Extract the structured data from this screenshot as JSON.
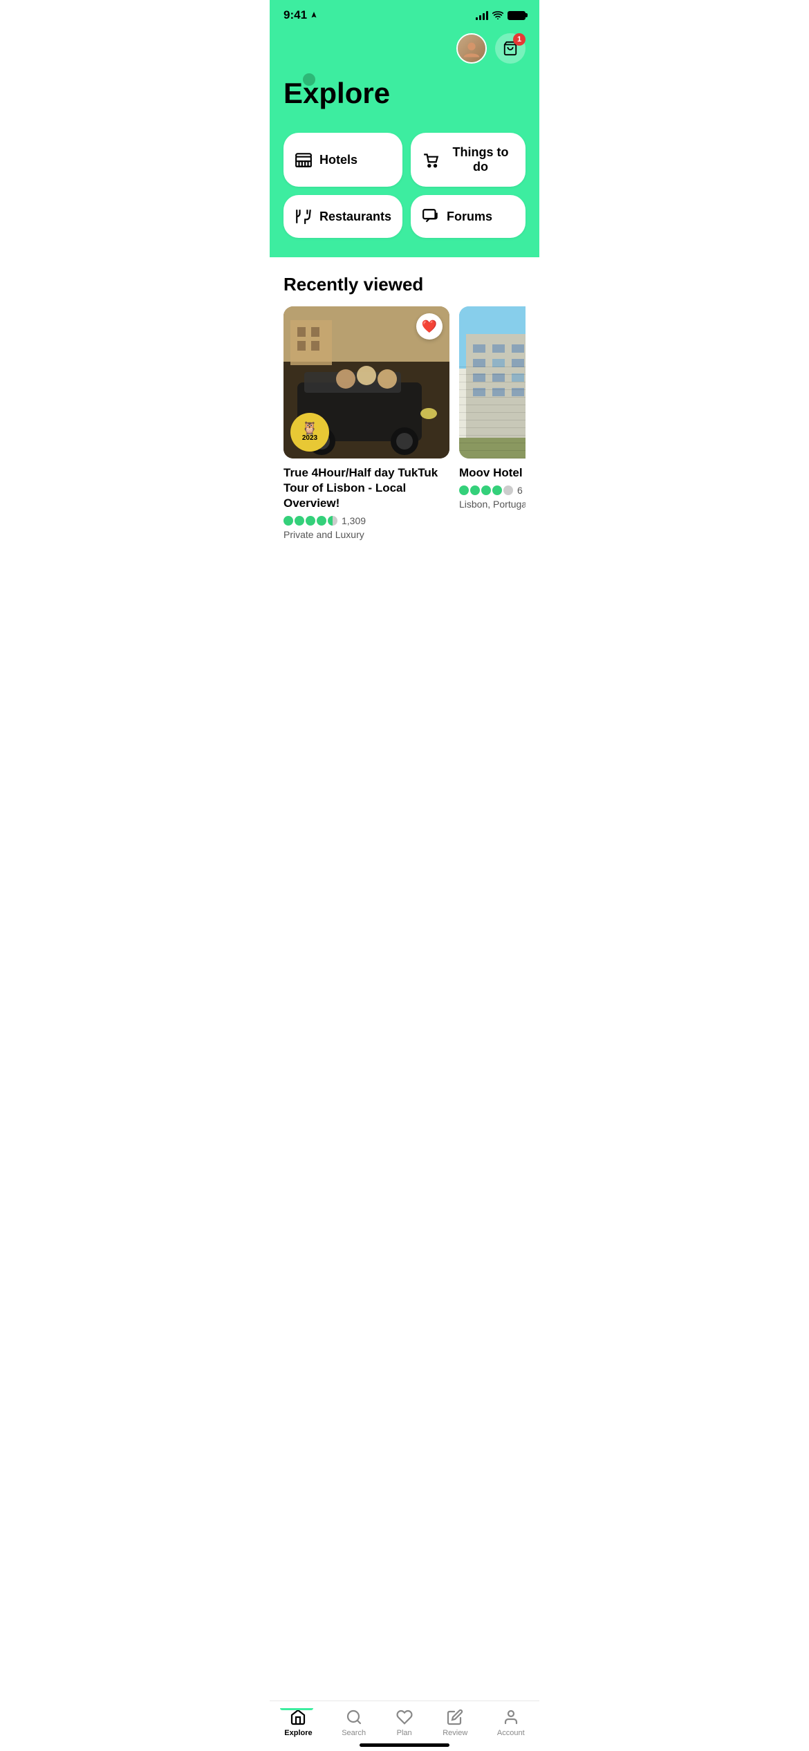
{
  "statusBar": {
    "time": "9:41",
    "cartBadge": "1"
  },
  "header": {
    "title": "Explore"
  },
  "categories": [
    {
      "id": "hotels",
      "label": "Hotels"
    },
    {
      "id": "things-to-do",
      "label": "Things to do"
    },
    {
      "id": "restaurants",
      "label": "Restaurants"
    },
    {
      "id": "forums",
      "label": "Forums"
    }
  ],
  "recentlyViewed": {
    "sectionTitle": "Recently viewed",
    "cards": [
      {
        "id": "tuktuk",
        "title": "True 4Hour/Half day TukTuk Tour of Lisbon - Local Overview!",
        "rating": 4.5,
        "reviewCount": "1,309",
        "subtitle": "Private and Luxury",
        "liked": true,
        "hasBadge": true,
        "badgeYear": "2023"
      },
      {
        "id": "moov-hotel",
        "title": "Moov Hotel Lisb...",
        "rating": 4,
        "reviewCount": "6",
        "subtitle": "Lisbon, Portugal",
        "liked": false,
        "hasBadge": false
      }
    ]
  },
  "bottomNav": [
    {
      "id": "explore",
      "label": "Explore",
      "active": true
    },
    {
      "id": "search",
      "label": "Search",
      "active": false
    },
    {
      "id": "plan",
      "label": "Plan",
      "active": false
    },
    {
      "id": "review",
      "label": "Review",
      "active": false
    },
    {
      "id": "account",
      "label": "Account",
      "active": false
    }
  ]
}
